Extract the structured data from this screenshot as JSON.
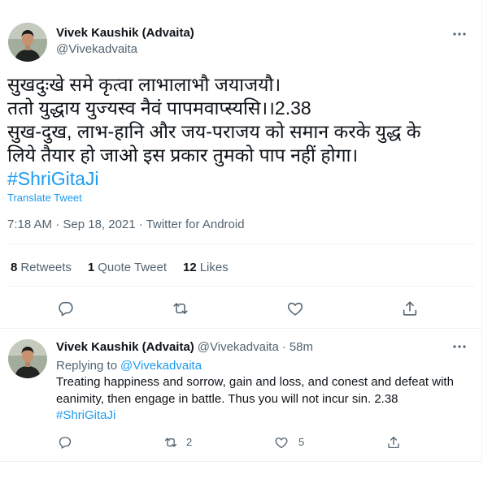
{
  "colors": {
    "text": "#0f1419",
    "secondary": "#536471",
    "accent": "#1d9bf0",
    "divider": "#eff3f4"
  },
  "icons": {
    "more": "more-icon",
    "reply": "reply-icon",
    "retweet": "retweet-icon",
    "like": "heart-icon",
    "share": "share-icon"
  },
  "main_tweet": {
    "author_name": "Vivek Kaushik (Advaita)",
    "author_handle": "@Vivekadvaita",
    "text_lines": [
      "सुखदुःखे समे कृत्वा लाभालाभौ जयाजयौ।",
      "ततो युद्धाय युज्यस्व नैवं पापमवाप्स्यसि।।2.38",
      "सुख-दुख, लाभ-हानि और जय-पराजय को समान करके युद्ध के",
      "लिये तैयार हो जाओ इस प्रकार तुमको पाप नहीं होगा।"
    ],
    "hashtag": "#ShriGitaJi",
    "translate_label": "Translate Tweet",
    "timestamp": "7:18 AM · Sep 18, 2021 · Twitter for Android",
    "stats": [
      {
        "count": "8",
        "label": "Retweets"
      },
      {
        "count": "1",
        "label": "Quote Tweet"
      },
      {
        "count": "12",
        "label": "Likes"
      }
    ]
  },
  "reply_tweet": {
    "author_name": "Vivek Kaushik (Advaita)",
    "author_handle": "@Vivekadvaita",
    "separator": "·",
    "time_ago": "58m",
    "replying_to_label": "Replying to",
    "replying_to_handle": "@Vivekadvaita",
    "text_lines": [
      "Treating happiness and sorrow, gain and loss, and conest and defeat with",
      "eanimity, then engage in battle. Thus you will not incur sin. 2.38"
    ],
    "hashtag": "#ShriGitaJi",
    "retweet_count": "2",
    "like_count": "5"
  }
}
